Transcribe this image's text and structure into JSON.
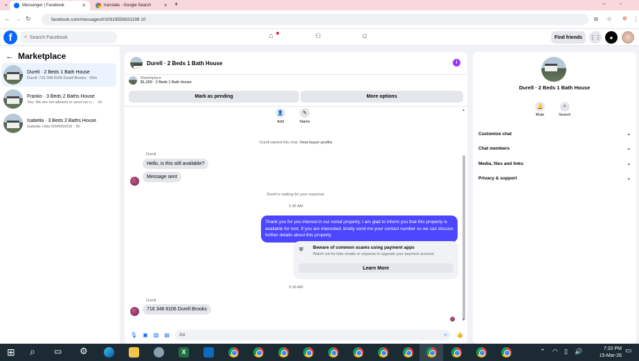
{
  "browser": {
    "tabs": [
      {
        "label": "Messenger | Facebook"
      },
      {
        "label": "translate - Google Search"
      }
    ],
    "new_tab": "+",
    "url": "facebook.com/messages/t/10919556931199 10"
  },
  "fb": {
    "search_placeholder": "Search Facebook",
    "find_friends": "Find friends",
    "logo": "f"
  },
  "left": {
    "title": "Marketplace",
    "conversations": [
      {
        "title": "Durell · 2 Beds 1 Bath House",
        "preview": "Durell: 716 348 8106 Durell Brooks · 50m"
      },
      {
        "title": "Franko · 3 Beds 2 Baths House",
        "preview": "You: We are not allowed to send our n... · 2h"
      },
      {
        "title": "Isabella · 3 Beds 2 Baths House",
        "preview": "Isabella: Hola 5094050015 · 2h"
      }
    ]
  },
  "chat": {
    "title": "Durell · 2 Beds 1 Bath House",
    "info_icon": "i",
    "marketplace_label": "Marketplace",
    "listing": "$1,000 · 2 Beds 1 Bath House",
    "mark_pending": "Mark as pending",
    "more_options": "More options",
    "add_label": "Add",
    "name_label": "Name",
    "started": "Durell started this chat.",
    "view_profile": "View buyer profile",
    "sender1": "Durell",
    "msg1": "Hello, is this still available?",
    "msg2": "Message sent",
    "waiting": "Durell is waiting for your response.",
    "time1": "5:35 AM",
    "reply": "Thank you for you interest in our rental property. I am glad to inform you that this property is available for rent. If you are interested, kindly send me your contact number so we can discuss further details about this property.",
    "scam_title": "Beware of common scams using payment apps",
    "scam_body": "Watch out for fake emails or requests to upgrade your payment account.",
    "learn_more": "Learn More",
    "time2": "6:39 AM",
    "sender2": "Durell",
    "msg3": "716 348 8106 Durell Brooks",
    "composer_placeholder": "Aa"
  },
  "right": {
    "name": "Durell · 2 Beds 1 Bath House",
    "mute": "Mute",
    "search": "Search",
    "rows": [
      "Customize chat",
      "Chat members",
      "Media, files and links",
      "Privacy & support"
    ]
  },
  "taskbar": {
    "time": "7:20 PM",
    "date": "15-Mar-26"
  },
  "colors": {
    "brand": "#0866ff",
    "outgoing": "#4d46ff",
    "info": "#a033ff"
  }
}
